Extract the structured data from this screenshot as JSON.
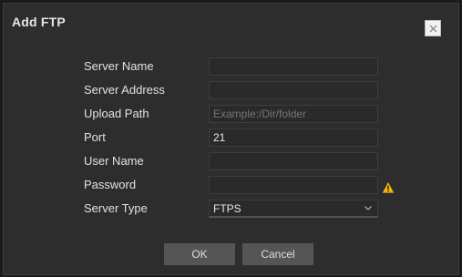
{
  "dialog": {
    "title": "Add FTP",
    "close_icon": "close-icon"
  },
  "form": {
    "server_name": {
      "label": "Server Name",
      "value": "",
      "placeholder": ""
    },
    "server_address": {
      "label": "Server Address",
      "value": "",
      "placeholder": ""
    },
    "upload_path": {
      "label": "Upload Path",
      "value": "",
      "placeholder": "Example:/Dir/folder"
    },
    "port": {
      "label": "Port",
      "value": "21",
      "placeholder": ""
    },
    "user_name": {
      "label": "User Name",
      "value": "",
      "placeholder": ""
    },
    "password": {
      "label": "Password",
      "value": "",
      "placeholder": "",
      "warning_icon": "warning-icon",
      "warning_color": "#f2b705"
    },
    "server_type": {
      "label": "Server Type",
      "selected": "FTPS",
      "caret_icon": "chevron-down-icon"
    }
  },
  "buttons": {
    "ok_label": "OK",
    "cancel_label": "Cancel"
  }
}
